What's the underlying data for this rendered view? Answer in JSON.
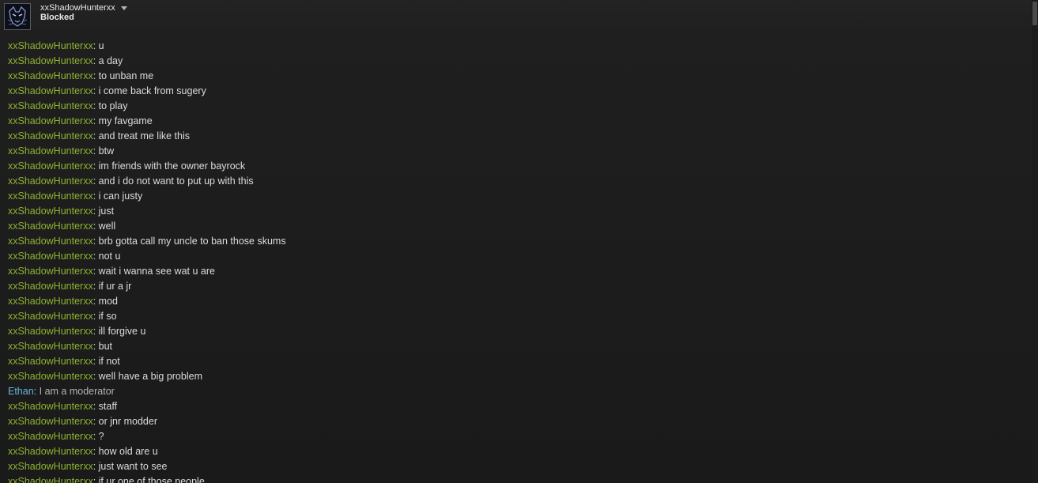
{
  "contact": {
    "name": "xxShadowHunterxx",
    "status": "Blocked",
    "avatar_icon": "wolf-avatar-icon",
    "friend_color": "#8db331",
    "self_color": "#6ab4dd"
  },
  "messages": [
    {
      "sender": "xxShadowHunterxx",
      "text": "u",
      "self": false
    },
    {
      "sender": "xxShadowHunterxx",
      "text": "a day",
      "self": false
    },
    {
      "sender": "xxShadowHunterxx",
      "text": "to unban me",
      "self": false
    },
    {
      "sender": "xxShadowHunterxx",
      "text": "i come back from sugery",
      "self": false
    },
    {
      "sender": "xxShadowHunterxx",
      "text": "to play",
      "self": false
    },
    {
      "sender": "xxShadowHunterxx",
      "text": "my favgame",
      "self": false
    },
    {
      "sender": "xxShadowHunterxx",
      "text": "and treat me like this",
      "self": false
    },
    {
      "sender": "xxShadowHunterxx",
      "text": "btw",
      "self": false
    },
    {
      "sender": "xxShadowHunterxx",
      "text": "im friends with the owner bayrock",
      "self": false
    },
    {
      "sender": "xxShadowHunterxx",
      "text": "and i do not want to put up with this",
      "self": false
    },
    {
      "sender": "xxShadowHunterxx",
      "text": "i can justy",
      "self": false
    },
    {
      "sender": "xxShadowHunterxx",
      "text": "just",
      "self": false
    },
    {
      "sender": "xxShadowHunterxx",
      "text": "well",
      "self": false
    },
    {
      "sender": "xxShadowHunterxx",
      "text": "brb gotta call my uncle to ban those skums",
      "self": false
    },
    {
      "sender": "xxShadowHunterxx",
      "text": "not u",
      "self": false
    },
    {
      "sender": "xxShadowHunterxx",
      "text": "wait i wanna see wat u are",
      "self": false
    },
    {
      "sender": "xxShadowHunterxx",
      "text": "if ur a jr",
      "self": false
    },
    {
      "sender": "xxShadowHunterxx",
      "text": "mod",
      "self": false
    },
    {
      "sender": "xxShadowHunterxx",
      "text": "if so",
      "self": false
    },
    {
      "sender": "xxShadowHunterxx",
      "text": "ill forgive u",
      "self": false
    },
    {
      "sender": "xxShadowHunterxx",
      "text": "but",
      "self": false
    },
    {
      "sender": "xxShadowHunterxx",
      "text": "if not",
      "self": false
    },
    {
      "sender": "xxShadowHunterxx",
      "text": "well have a big problem",
      "self": false
    },
    {
      "sender": "Ethan",
      "text": "I am a moderator",
      "self": true
    },
    {
      "sender": "xxShadowHunterxx",
      "text": "staff",
      "self": false
    },
    {
      "sender": "xxShadowHunterxx",
      "text": "or jnr modder",
      "self": false
    },
    {
      "sender": "xxShadowHunterxx",
      "text": "?",
      "self": false
    },
    {
      "sender": "xxShadowHunterxx",
      "text": "how old are u",
      "self": false
    },
    {
      "sender": "xxShadowHunterxx",
      "text": "just want to see",
      "self": false
    },
    {
      "sender": "xxShadowHunterxx",
      "text": "if ur one of those people",
      "self": false
    }
  ]
}
